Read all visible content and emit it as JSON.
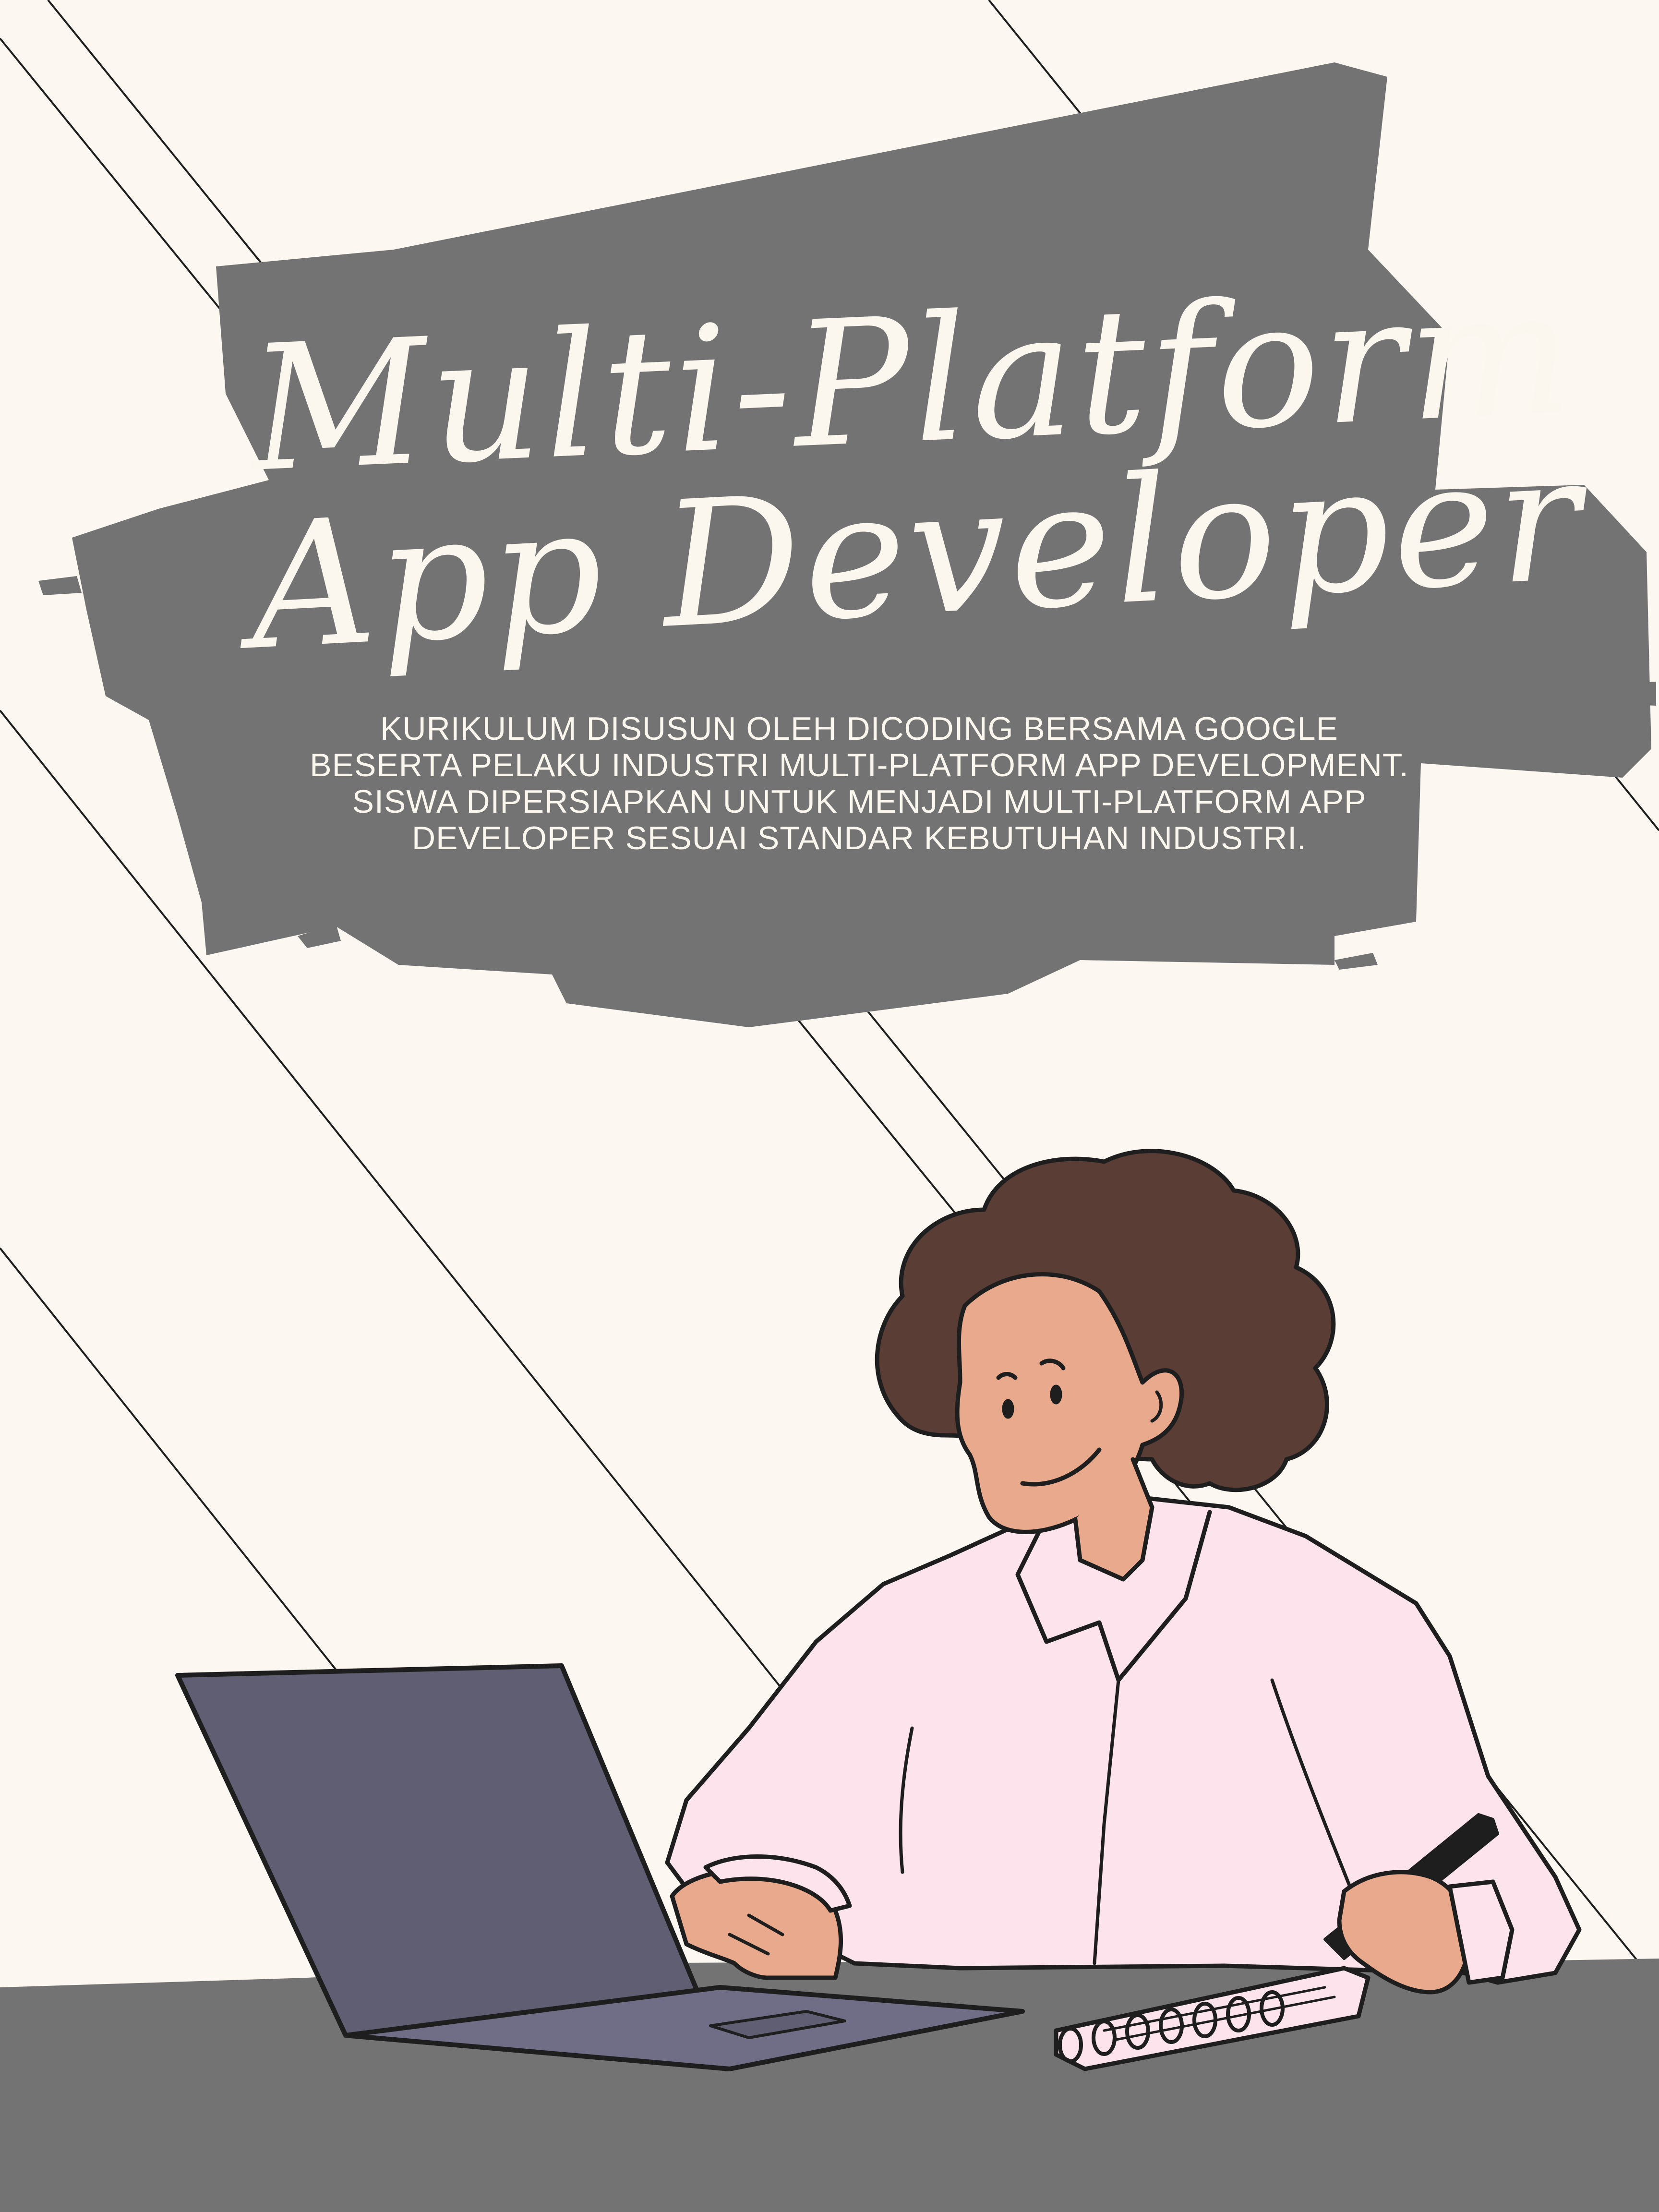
{
  "poster": {
    "title_line_1": "Multi-Platform",
    "title_line_2": "App Developer",
    "description": "KURIKULUM DISUSUN OLEH DICODING BERSAMA GOOGLE BESERTA PELAKU INDUSTRI MULTI-PLATFORM APP DEVELOPMENT. SISWA DIPERSIAPKAN UNTUK MENJADI MULTI-PLATFORM APP DEVELOPER SESUAI STANDAR KEBUTUHAN INDUSTRI."
  },
  "colors": {
    "background": "#fcf8f1",
    "brush_gray": "#737373",
    "text_light": "#fbf7ee",
    "outline": "#1e1e1e",
    "hair": "#5a3e36",
    "skin": "#e8a98c",
    "shirt": "#fde3ec",
    "laptop_screen": "#5f5e73",
    "laptop_base": "#6f6e86",
    "notebook": "#fde3ec"
  },
  "icons": {
    "illustration": "woman-working-at-laptop-illustration"
  }
}
